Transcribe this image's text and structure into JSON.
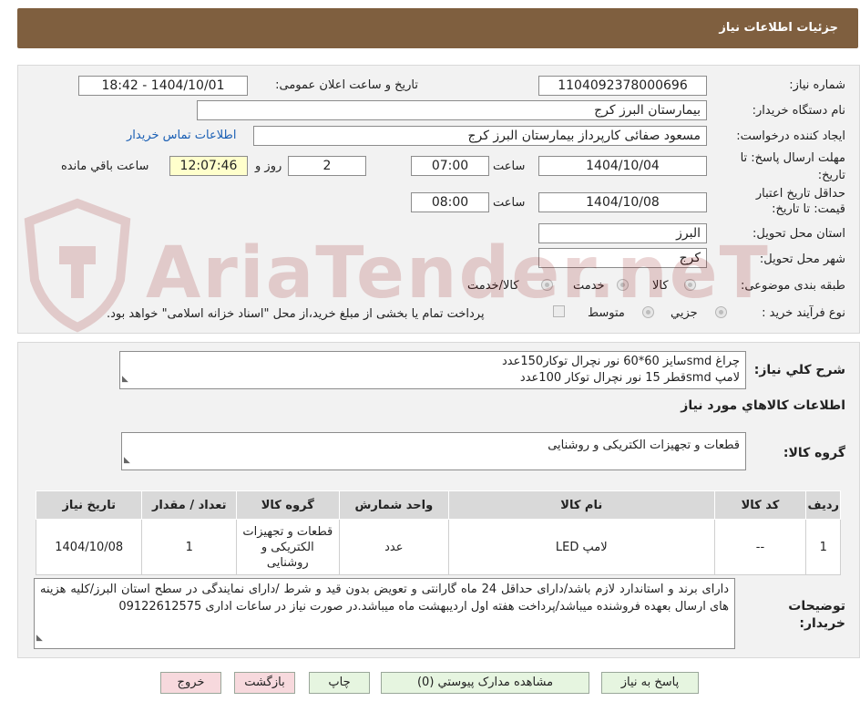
{
  "header": {
    "title": "جزئیات اطلاعات نیاز"
  },
  "details": {
    "need_number_label": "شماره نیاز:",
    "need_number": "1104092378000696",
    "announce_label": "تاریخ و ساعت اعلان عمومی:",
    "announce_value": "1404/10/01 - 18:42",
    "buyer_org_label": "نام دستگاه خریدار:",
    "buyer_org": "بیمارستان البرز کرج",
    "requester_label": "ایجاد کننده درخواست:",
    "requester": "مسعود صفائی کارپرداز بیمارستان البرز کرج",
    "contact_link": "اطلاعات تماس خریدار",
    "deadline_label_1": "مهلت ارسال پاسخ: تا",
    "deadline_label_2": "تاریخ:",
    "deadline_date": "1404/10/04",
    "hour_label": "ساعت",
    "deadline_time": "07:00",
    "days_value": "2",
    "days_label": "روز و",
    "remaining_time": "12:07:46",
    "remaining_label": "ساعت باقي مانده",
    "validity_label_1": "حداقل تاریخ اعتبار",
    "validity_label_2": "قیمت: تا تاریخ:",
    "validity_date": "1404/10/08",
    "validity_time": "08:00",
    "province_label": "استان محل تحویل:",
    "province": "البرز",
    "city_label": "شهر محل تحویل:",
    "city": "کرج",
    "category_label": "طبقه بندی موضوعی:",
    "category_options": [
      "کالا",
      "خدمت",
      "کالا/خدمت"
    ],
    "process_label": "نوع فرآیند خرید :",
    "process_options": [
      "جزیي",
      "متوسط"
    ],
    "process_note": "پرداخت تمام یا بخشی از مبلغ خرید،از محل \"اسناد خزانه اسلامی\" خواهد بود."
  },
  "summary": {
    "label": "شرح کلي نياز:",
    "line1": "چراغ smdسایز 60*60 نور نچرال توکار150عدد",
    "line2": "لامپ smdقطر 15 نور نچرال توکار 100عدد"
  },
  "goods": {
    "section_title": "اطلاعات کالاهاي مورد نياز",
    "group_label": "گروه کالا:",
    "group_value": "قطعات و تجهیزات الکتریکی و روشنایی",
    "columns": [
      "رديف",
      "کد کالا",
      "نام کالا",
      "واحد شمارش",
      "گروه کالا",
      "تعداد / مقدار",
      "تاریخ نیاز"
    ],
    "rows": [
      {
        "index": "1",
        "code": "--",
        "name": "لامپ LED",
        "unit": "عدد",
        "group": "قطعات و تجهیزات الکتریکی و روشنایی",
        "qty": "1",
        "date": "1404/10/08"
      }
    ]
  },
  "buyer_notes": {
    "label_1": "توضیحات",
    "label_2": "خریدار:",
    "text": "دارای برند و استاندارد لازم باشد/دارای حداقل 24 ماه گارانتی و تعویض بدون قید و شرط /دارای نمایندگی در سطح استان البرز/کلیه هزینه های ارسال بعهده فروشنده میباشد/پرداخت هفته اول اردیبهشت ماه میباشد.در صورت نیاز در ساعات اداری 09122612575"
  },
  "buttons": {
    "reply": "پاسخ به نیاز",
    "attachments": "مشاهده مدارک پیوستي (0)",
    "print": "چاپ",
    "back": "بازگشت",
    "exit": "خروج"
  },
  "watermark": {
    "text": "AriaTender.neT"
  },
  "colors": {
    "header_bg": "#7f5f3f",
    "panel_bg": "#f2f2f2",
    "link": "#1a5fb4",
    "time_bg": "#ffffcc",
    "btn_green": "#e6f5e0",
    "btn_pink": "#f7d9dd"
  }
}
